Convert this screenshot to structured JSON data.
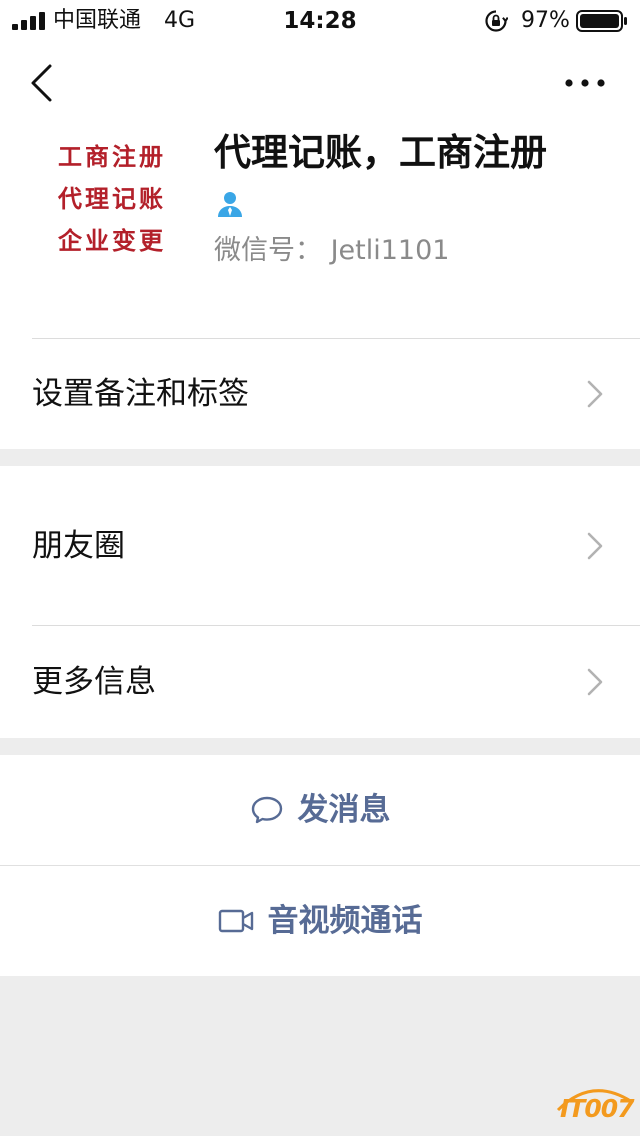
{
  "status_bar": {
    "carrier": "中国联通",
    "network": "4G",
    "time": "14:28",
    "battery_percent": "97%"
  },
  "avatar": {
    "lines": [
      "工商注册",
      "代理记账",
      "企业变更"
    ],
    "text_color": "#b3202a"
  },
  "profile": {
    "name": "代理记账，工商注册",
    "wechat_id": "微信号： Jetli1101"
  },
  "rows": {
    "remark": "设置备注和标签",
    "moments": "朋友圈",
    "more_info": "更多信息"
  },
  "actions": {
    "message": "发消息",
    "video_call": "音视频通话"
  },
  "colors": {
    "link": "#576b95",
    "background": "#ededed"
  },
  "icons": {
    "back": "chevron-left-icon",
    "more": "more-dots-icon",
    "person": "person-icon",
    "chevron": "chevron-right-icon",
    "message": "chat-bubble-icon",
    "video": "video-camera-icon"
  },
  "watermark": {
    "text": "IT007"
  }
}
